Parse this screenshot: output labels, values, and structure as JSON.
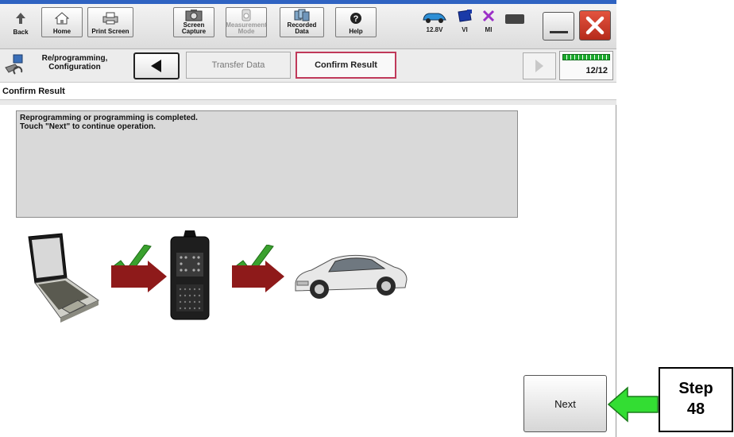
{
  "toolbar": {
    "back_label": "Back",
    "home_label": "Home",
    "print_label": "Print Screen",
    "capture_label": "Screen Capture",
    "measurement_label": "Measurement Mode",
    "recorded_label": "Recorded Data",
    "help_label": "Help"
  },
  "status": {
    "battery_label": "12.8V",
    "vi_label": "VI",
    "mi_label": "MI"
  },
  "breadcrumb": {
    "step1_label": "Re/programming, Configuration",
    "step2_label": "Transfer Data",
    "step3_label": "Confirm Result",
    "page_counter": "12/12",
    "progress_fraction": 1.0
  },
  "section": {
    "title": "Confirm Result"
  },
  "message": {
    "line1": "Reprogramming or programming is completed.",
    "line2": "Touch \"Next\" to continue operation."
  },
  "actions": {
    "next_label": "Next"
  },
  "annotation": {
    "step_label_1": "Step",
    "step_label_2": "48"
  },
  "colors": {
    "accent_red": "#c0395a",
    "check_green": "#3aa12e",
    "arrow_red": "#8e1a1a",
    "callout_green": "#33dd33"
  }
}
